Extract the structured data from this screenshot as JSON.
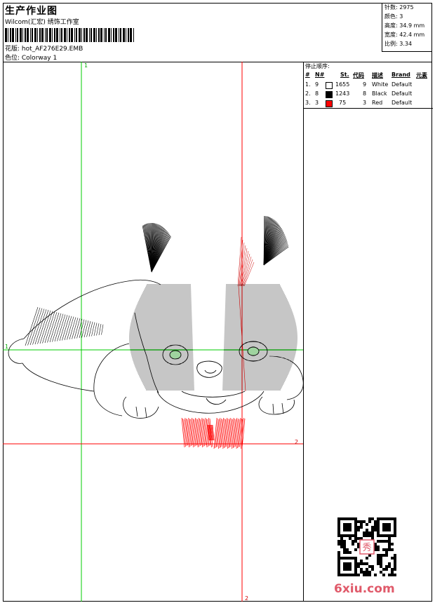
{
  "header": {
    "title": "生产作业图",
    "studio": "Wilcom(汇宏) 绣饰工作室",
    "design_file": "花版: hot_AF276E29.EMB",
    "colorway": "色位: Colorway 1"
  },
  "stats": [
    {
      "label": "针数",
      "value": "2975"
    },
    {
      "label": "颜色",
      "value": "3"
    },
    {
      "label": "高度",
      "value": "34.9 mm"
    },
    {
      "label": "宽度",
      "value": "42.4 mm"
    },
    {
      "label": "比例",
      "value": "3.34"
    }
  ],
  "stop_sequence": {
    "title": "停止顺序:",
    "columns": [
      "#",
      "N#",
      "St.",
      "代码",
      "描述",
      "Brand",
      "元素"
    ],
    "rows": [
      {
        "index": "1.",
        "needle": "9",
        "swatch": "#ffffff",
        "stitches": "1655",
        "code": "9",
        "description": "White",
        "brand": "Default"
      },
      {
        "index": "2.",
        "needle": "8",
        "swatch": "#000000",
        "stitches": "1243",
        "code": "8",
        "description": "Black",
        "brand": "Default"
      },
      {
        "index": "3.",
        "needle": "3",
        "swatch": "#ff0000",
        "stitches": "75",
        "code": "3",
        "description": "Red",
        "brand": "Default"
      }
    ]
  },
  "guides": {
    "green_top_label": "1",
    "green_left_label": "1",
    "red_right_label": "2",
    "red_bottom_label": "2",
    "green_color": "#00cc00",
    "red_color": "#ff0000"
  },
  "watermark": "6xiu.com",
  "qr_badge": "秀"
}
